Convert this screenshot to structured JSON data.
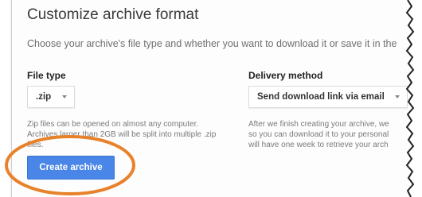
{
  "dialog": {
    "title": "Customize archive format",
    "subtitle": "Choose your archive's file type and whether you want to download it or save it in the"
  },
  "file_type": {
    "label": "File type",
    "selected": ".zip",
    "helper_lines": [
      "Zip files can be opened on almost any computer.",
      "Archives larger than 2GB will be split into multiple .zip",
      "files."
    ]
  },
  "delivery": {
    "label": "Delivery method",
    "selected": "Send download link via email",
    "helper_lines": [
      "After we finish creating your archive, we",
      "so you can download it to your personal",
      "will have one week to retrieve your arch"
    ]
  },
  "actions": {
    "create_label": "Create archive"
  },
  "colors": {
    "primary_button": "#4a86e8",
    "highlight_circle": "#e8822a"
  },
  "icons": {
    "select_caret": "chevron-down-icon"
  }
}
